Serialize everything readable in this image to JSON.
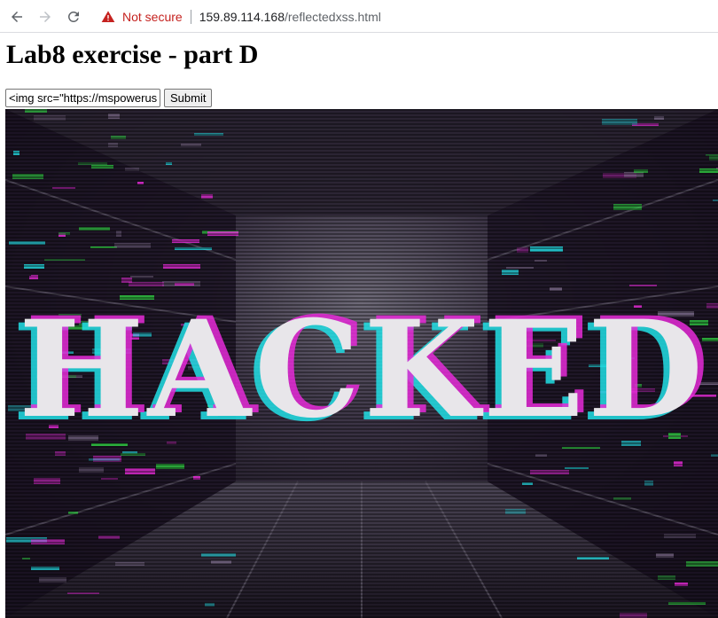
{
  "browser": {
    "security_label": "Not secure",
    "url_host": "159.89.114.168",
    "url_path": "/reflectedxss.html",
    "icons": [
      "back-arrow-icon",
      "forward-arrow-icon",
      "reload-icon",
      "warning-triangle-icon"
    ],
    "colors": {
      "security_red": "#c5221f"
    }
  },
  "page": {
    "title": "Lab8 exercise - part D",
    "input_value": "<img src=\"https://mspowerus",
    "submit_label": "Submit"
  },
  "injected_image": {
    "text": "HACKED",
    "colors": {
      "cyan": "#22e0e6",
      "magenta": "#e62bd8",
      "green": "#2ecc40"
    }
  }
}
